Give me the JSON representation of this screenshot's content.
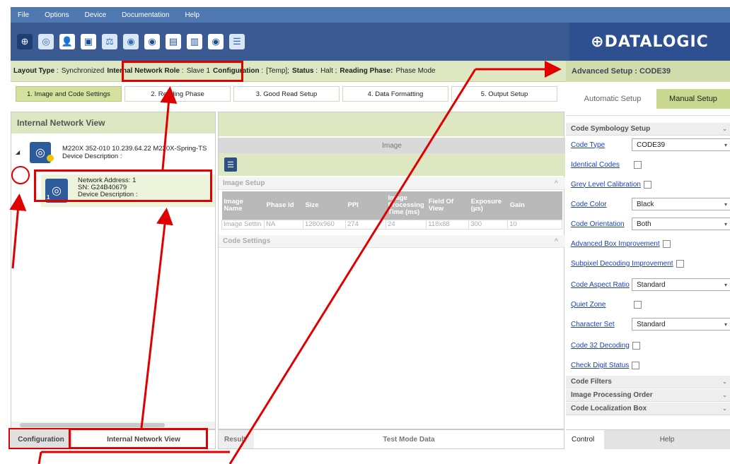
{
  "menu": [
    "File",
    "Options",
    "Device",
    "Documentation",
    "Help"
  ],
  "toolbar": {
    "icons": [
      "plus-circle-icon",
      "scanner-settings-icon",
      "user-icon",
      "window-icon",
      "balance-icon",
      "device-save-icon",
      "device-load-icon",
      "screen-export-icon",
      "screen-import-icon",
      "device-monitor-icon",
      "signal-tree-icon"
    ],
    "logo": "⊕DATALOGIC"
  },
  "status": {
    "layout_type_label": "Layout Type",
    "layout_type_value": "Synchronized",
    "role_label": "Internal Network Role",
    "role_value": "Slave 1",
    "configuration_label": "Configuration",
    "configuration_value": "[Temp];",
    "status_label": "Status",
    "status_value": "Halt ;",
    "reading_phase_label": "Reading Phase:",
    "reading_phase_value": "Phase Mode"
  },
  "steps": [
    "1. Image and Code Settings",
    "2. Reading Phase",
    "3. Good Read Setup",
    "4. Data Formatting",
    "5. Output Setup"
  ],
  "left_panel": {
    "title": "Internal Network View",
    "master": {
      "line1": "M220X 352-010 10.239.64.22 M220X-Spring-TS",
      "line2": "Device Description :"
    },
    "slave": {
      "address": "Network Address:   1",
      "sn": "SN:   G24B40679",
      "description": "Device Description :",
      "number": "1"
    }
  },
  "bottom_left_tabs": {
    "configuration": "Configuration",
    "network": "Internal Network View"
  },
  "middle": {
    "image_label": "Image",
    "image_setup": "Image Setup",
    "code_settings": "Code Settings",
    "table_headers": [
      "Image Name",
      "Phase Id",
      "Size",
      "PPI",
      "Image Processing Time (ms)",
      "Field Of View",
      "Exposure (µs)",
      "Gain"
    ],
    "table_row": [
      "Image Settin",
      "NA",
      "1280x960",
      "274",
      "24",
      "118x88",
      "300",
      "10"
    ],
    "results_tab": "Result",
    "test_tab": "Test Mode Data"
  },
  "right_panel": {
    "title": "Advanced Setup  :  CODE39",
    "automatic": "Automatic Setup",
    "manual": "Manual Setup",
    "symbology_header": "Code Symbology Setup",
    "code_type_label": "Code Type",
    "code_type_value": "CODE39",
    "identical_codes": "Identical Codes",
    "grey_level": "Grey Level Calibration",
    "code_color_label": "Code Color",
    "code_color_value": "Black",
    "code_orientation_label": "Code Orientation",
    "code_orientation_value": "Both",
    "advanced_box": "Advanced Box Improvement",
    "subpixel": "Subpixel Decoding Improvement",
    "aspect_label": "Code Aspect Ratio",
    "aspect_value": "Standard",
    "quiet_zone": "Quiet Zone",
    "charset_label": "Character Set",
    "charset_value": "Standard",
    "code32": "Code 32 Decoding",
    "check_digit": "Check Digit Status",
    "filters": "Code Filters",
    "processing_order": "Image Processing Order",
    "localization": "Code Localization Box",
    "control_tab": "Control",
    "help_tab": "Help"
  },
  "colors": {
    "menu": "#4f78b0",
    "toolbar": "#3a5a91",
    "accent_green": "#dde7c1",
    "active_green": "#c9d88f",
    "annotation_red": "#e00000"
  }
}
